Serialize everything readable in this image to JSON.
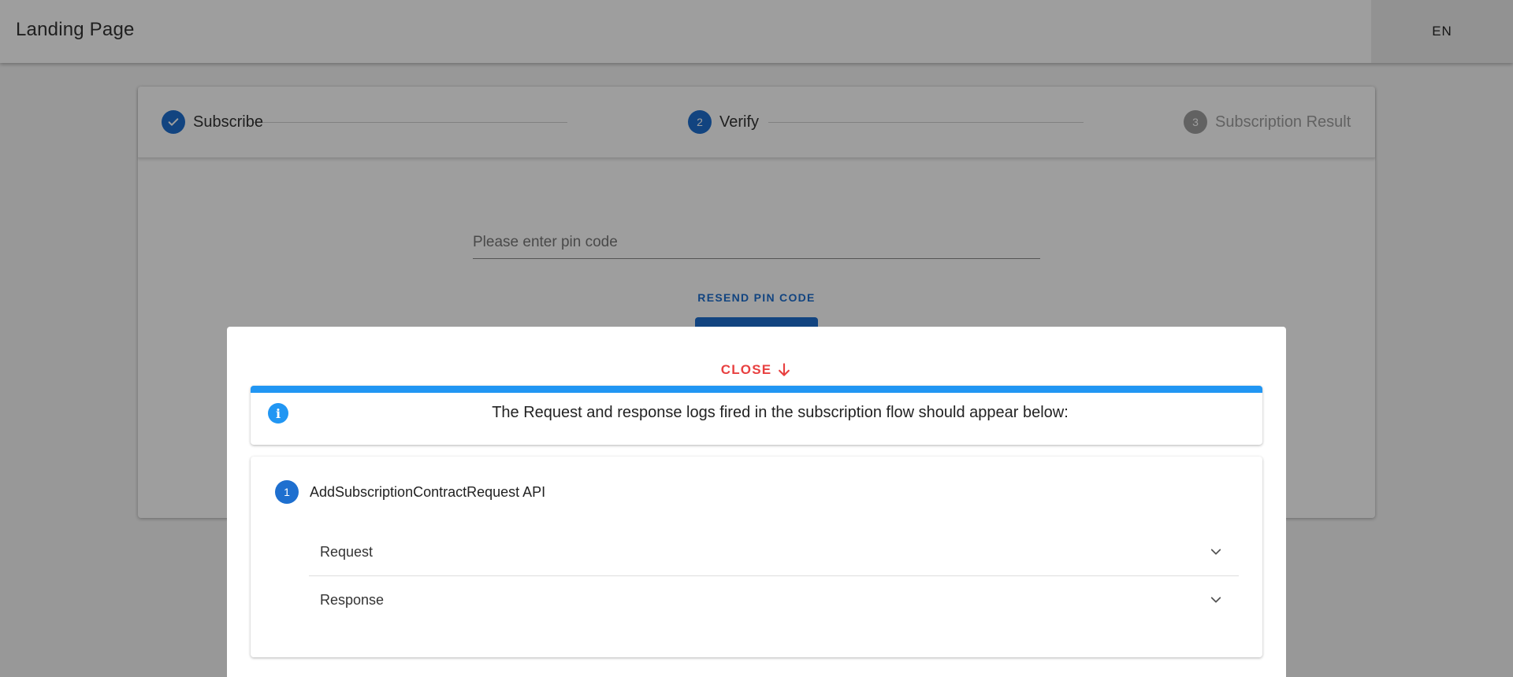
{
  "appbar": {
    "title": "Landing Page",
    "language": "EN"
  },
  "stepper": {
    "steps": [
      {
        "label": "Subscribe",
        "state": "done",
        "icon": "check-icon"
      },
      {
        "label": "Verify",
        "state": "active",
        "number": "2"
      },
      {
        "label": "Subscription Result",
        "state": "pending",
        "number": "3"
      }
    ]
  },
  "form": {
    "pin_placeholder": "Please enter pin code",
    "resend_label": "RESEND PIN CODE"
  },
  "modal": {
    "close_label": "CLOSE",
    "info_text": "The Request and response logs fired in the subscription flow should appear below:",
    "logs": [
      {
        "number": "1",
        "title": "AddSubscriptionContractRequest API",
        "panels": [
          {
            "label": "Request"
          },
          {
            "label": "Response"
          }
        ]
      }
    ]
  },
  "colors": {
    "primary": "#1e6fcf",
    "info": "#2196f3",
    "close": "#e84040",
    "pending": "#9e9e9e"
  }
}
